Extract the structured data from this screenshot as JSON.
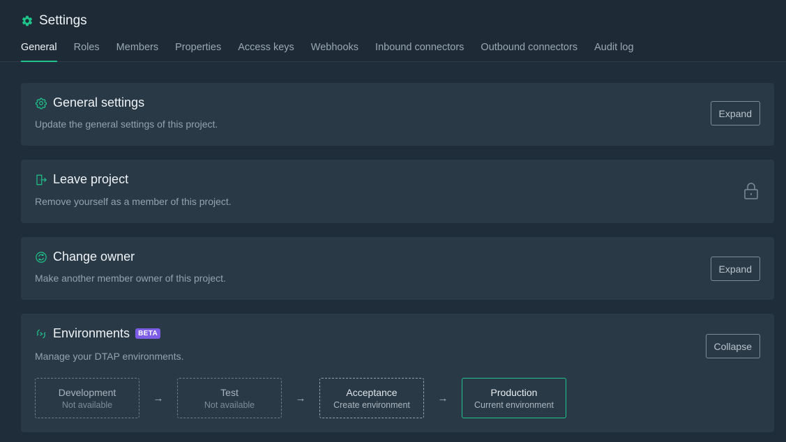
{
  "header": {
    "title": "Settings",
    "icon": "gear-icon",
    "tabs": [
      {
        "label": "General",
        "active": true
      },
      {
        "label": "Roles"
      },
      {
        "label": "Members"
      },
      {
        "label": "Properties"
      },
      {
        "label": "Access keys"
      },
      {
        "label": "Webhooks"
      },
      {
        "label": "Inbound connectors"
      },
      {
        "label": "Outbound connectors"
      },
      {
        "label": "Audit log"
      }
    ]
  },
  "cards": {
    "general": {
      "icon": "gear-outline-icon",
      "title": "General settings",
      "description": "Update the general settings of this project.",
      "button": "Expand"
    },
    "leave": {
      "icon": "exit-door-icon",
      "title": "Leave project",
      "description": "Remove yourself as a member of this project.",
      "status_icon": "lock-icon"
    },
    "owner": {
      "icon": "swap-circle-icon",
      "title": "Change owner",
      "description": "Make another member owner of this project.",
      "button": "Expand"
    },
    "environments": {
      "icon": "environments-icon",
      "title": "Environments",
      "badge": "BETA",
      "description": "Manage your DTAP environments.",
      "button": "Collapse",
      "arrow": "→",
      "items": [
        {
          "name": "Development",
          "status": "Not available"
        },
        {
          "name": "Test",
          "status": "Not available"
        },
        {
          "name": "Acceptance",
          "status": "Create environment"
        },
        {
          "name": "Production",
          "status": "Current environment"
        }
      ]
    }
  },
  "colors": {
    "background": "#1f2d3a",
    "card": "#2a3946",
    "accent": "#1fc48b",
    "beta": "#7d5ce6"
  }
}
